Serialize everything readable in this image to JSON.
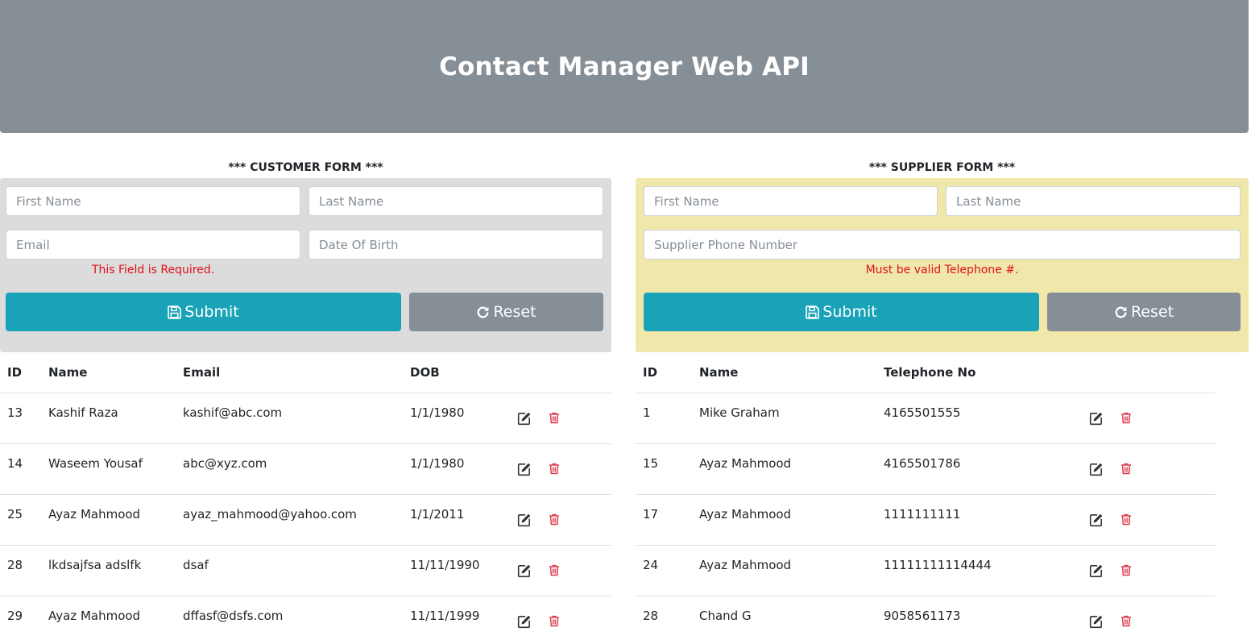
{
  "header": {
    "title": "Contact Manager Web API"
  },
  "customer_form": {
    "title": "*** CUSTOMER FORM ***",
    "first_name_placeholder": "First Name",
    "last_name_placeholder": "Last Name",
    "email_placeholder": "Email",
    "dob_placeholder": "Date Of Birth",
    "error": "This Field is Required.",
    "submit_label": "Submit",
    "reset_label": "Reset"
  },
  "supplier_form": {
    "title": "*** SUPPLIER FORM ***",
    "first_name_placeholder": "First Name",
    "last_name_placeholder": "Last Name",
    "phone_placeholder": "Supplier Phone Number",
    "error": "Must be valid Telephone #.",
    "submit_label": "Submit",
    "reset_label": "Reset"
  },
  "customer_table": {
    "columns": [
      "ID",
      "Name",
      "Email",
      "DOB"
    ],
    "rows": [
      {
        "id": "13",
        "name": "Kashif Raza",
        "email": "kashif@abc.com",
        "dob": "1/1/1980"
      },
      {
        "id": "14",
        "name": "Waseem Yousaf",
        "email": "abc@xyz.com",
        "dob": "1/1/1980"
      },
      {
        "id": "25",
        "name": "Ayaz Mahmood",
        "email": "ayaz_mahmood@yahoo.com",
        "dob": "1/1/2011"
      },
      {
        "id": "28",
        "name": "lkdsajfsa adslfk",
        "email": "dsaf",
        "dob": "11/11/1990"
      },
      {
        "id": "29",
        "name": "Ayaz Mahmood",
        "email": "dffasf@dsfs.com",
        "dob": "11/11/1999"
      }
    ]
  },
  "supplier_table": {
    "columns": [
      "ID",
      "Name",
      "Telephone No"
    ],
    "rows": [
      {
        "id": "1",
        "name": "Mike Graham",
        "phone": "4165501555"
      },
      {
        "id": "15",
        "name": "Ayaz Mahmood",
        "phone": "4165501786"
      },
      {
        "id": "17",
        "name": "Ayaz Mahmood",
        "phone": "1111111111"
      },
      {
        "id": "24",
        "name": "Ayaz Mahmood",
        "phone": "11111111114444"
      },
      {
        "id": "28",
        "name": "Chand G",
        "phone": "9058561173"
      }
    ]
  },
  "icons": {
    "edit": "edit-icon",
    "delete": "trash-icon",
    "save": "floppy-disk-icon",
    "refresh": "refresh-icon"
  },
  "colors": {
    "header_bg": "#868e96",
    "customer_panel_bg": "#dcdcdc",
    "supplier_panel_bg": "#f0e7ab",
    "primary": "#1aa3b8",
    "secondary": "#868e96",
    "error": "#e0101b",
    "delete_icon": "#dc3545"
  }
}
